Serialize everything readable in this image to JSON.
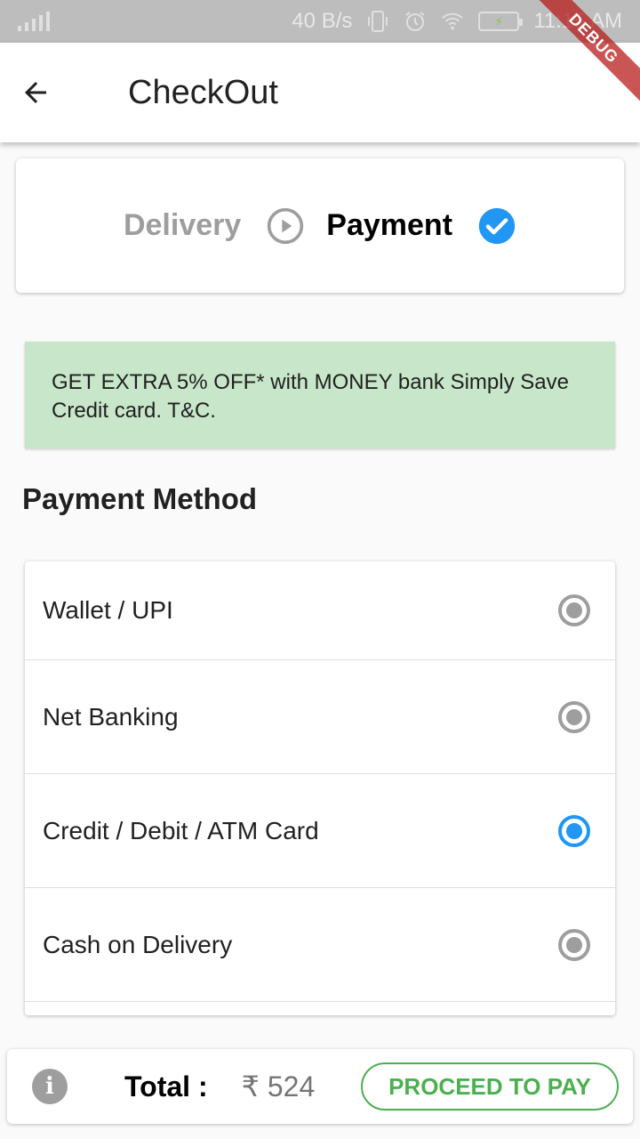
{
  "status_bar": {
    "net_speed": "40 B/s",
    "time": "11:15 AM"
  },
  "debug_banner": "DEBUG",
  "app_bar": {
    "title": "CheckOut",
    "back_icon": "arrow-back-icon"
  },
  "steps": {
    "step1_label": "Delivery",
    "step1_icon": "play-circle-outline-icon",
    "step2_label": "Payment",
    "step2_icon": "check-circle-icon"
  },
  "offer": {
    "text": "GET EXTRA 5% OFF* with MONEY bank Simply Save Credit card. T&C."
  },
  "payment_section": {
    "title": "Payment Method",
    "methods": [
      {
        "label": "Wallet / UPI",
        "selected": false
      },
      {
        "label": "Net Banking",
        "selected": false
      },
      {
        "label": "Credit / Debit / ATM Card",
        "selected": true
      },
      {
        "label": "Cash on Delivery",
        "selected": false
      }
    ]
  },
  "bottom_bar": {
    "info_icon": "info-icon",
    "total_label": "Total :",
    "total_value": "₹ 524",
    "proceed_label": "PROCEED TO PAY"
  },
  "colors": {
    "accent_blue": "#2196f3",
    "proceed_green": "#4caf50",
    "offer_bg": "#c8e6c9",
    "inactive_grey": "#9e9e9e"
  }
}
